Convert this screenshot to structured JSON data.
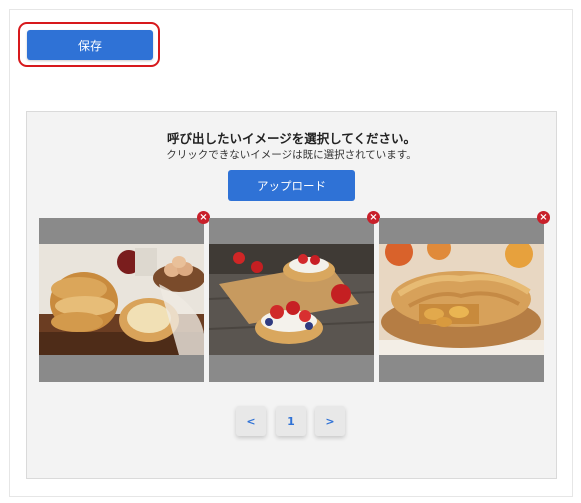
{
  "toolbar": {
    "save_label": "保存"
  },
  "selector": {
    "title": "呼び出したいイメージを選択してください。",
    "subtitle": "クリックできないイメージは既に選択されています。",
    "upload_label": "アップロード"
  },
  "images": [
    {
      "alt": "bread",
      "remove_icon": "close-icon"
    },
    {
      "alt": "tarts",
      "remove_icon": "close-icon"
    },
    {
      "alt": "apple-pie",
      "remove_icon": "close-icon"
    }
  ],
  "pagination": {
    "prev": "<",
    "page": "1",
    "next": ">"
  },
  "colors": {
    "accent": "#2f72d6",
    "highlight": "#d7191c",
    "remove": "#c8202a"
  }
}
